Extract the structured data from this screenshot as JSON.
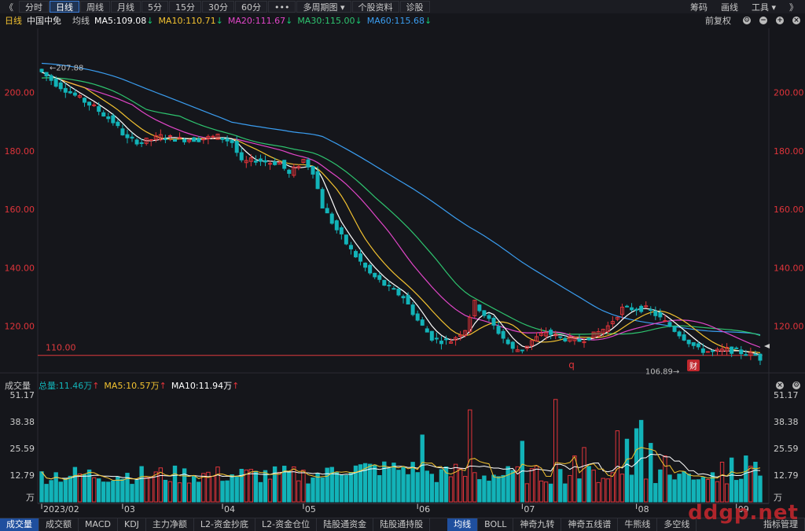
{
  "toolbar": {
    "nav_left": "《",
    "items": [
      "分时",
      "日线",
      "周线",
      "月线",
      "5分",
      "15分",
      "30分",
      "60分",
      "•••",
      "多周期图 ▾",
      "个股资料",
      "诊股"
    ],
    "active_index": 1,
    "right": [
      "筹码",
      "画线",
      "工具 ▾",
      "》"
    ]
  },
  "header": {
    "period": "日线",
    "stock_name": "中国中免",
    "ma_label": "均线",
    "ma5": "MA5:109.08",
    "ma10": "MA10:110.71",
    "ma20": "MA20:111.67",
    "ma30": "MA30:115.00",
    "ma60": "MA60:115.68",
    "adjust": "前复权"
  },
  "volume_header": {
    "label": "成交量",
    "total": "总量:11.46万",
    "ma5": "MA5:10.57万",
    "ma10": "MA10:11.94万"
  },
  "bottom_tabs": [
    "成交量",
    "成交额",
    "MACD",
    "KDJ",
    "主力净额",
    "L2-资金抄底",
    "L2-资金仓位",
    "陆股通资金",
    "陆股通持股",
    "均线",
    "BOLL",
    "神奇九转",
    "神奇五线谱",
    "牛熊线",
    "多空线"
  ],
  "bottom_active": [
    0,
    9
  ],
  "bottom_right": "指标管理",
  "watermark": "ddgp.net",
  "colors": {
    "up": "#e0343a",
    "down": "#12b3b8",
    "ma5": "#ffffff",
    "ma10": "#f2c230",
    "ma20": "#e146c8",
    "ma30": "#2ec46f",
    "ma60": "#3a9df0",
    "price_axis": "#e0343a",
    "grid_line": "#e03a3e"
  },
  "chart_data": [
    {
      "type": "candlestick",
      "title": "中国中免 日线",
      "ylim": [
        104,
        222
      ],
      "yticks": [
        "200.00",
        "180.00",
        "160.00",
        "140.00",
        "120.00"
      ],
      "ytick_values": [
        200,
        180,
        160,
        140,
        120
      ],
      "x_labels": [
        "2023/02",
        "03",
        "04",
        "05",
        "06",
        "07",
        "08",
        "09"
      ],
      "x_label_positions": [
        0,
        17,
        38,
        55,
        79,
        101,
        125,
        146
      ],
      "reference_line": {
        "value": 110,
        "label": "110.00"
      },
      "annotations": {
        "high": "207.88",
        "low": "106.89",
        "q_marker": "q",
        "fin_marker": "财"
      },
      "anchors": [
        [
          0,
          207
        ],
        [
          3,
          203
        ],
        [
          7,
          199
        ],
        [
          11,
          195
        ],
        [
          15,
          190
        ],
        [
          18,
          184
        ],
        [
          21,
          183
        ],
        [
          25,
          185
        ],
        [
          29,
          184
        ],
        [
          33,
          184
        ],
        [
          37,
          185
        ],
        [
          40,
          183
        ],
        [
          42,
          176
        ],
        [
          45,
          177
        ],
        [
          48,
          176
        ],
        [
          50,
          176
        ],
        [
          52,
          172
        ],
        [
          55,
          177
        ],
        [
          57,
          173
        ],
        [
          59,
          161
        ],
        [
          62,
          153
        ],
        [
          65,
          146
        ],
        [
          69,
          138
        ],
        [
          73,
          133
        ],
        [
          76,
          130
        ],
        [
          79,
          122
        ],
        [
          82,
          116
        ],
        [
          84,
          115
        ],
        [
          86,
          115
        ],
        [
          89,
          119
        ],
        [
          91,
          128
        ],
        [
          93,
          124
        ],
        [
          95,
          120
        ],
        [
          97,
          116
        ],
        [
          99,
          112
        ],
        [
          101,
          112
        ],
        [
          103,
          115
        ],
        [
          106,
          118
        ],
        [
          109,
          116
        ],
        [
          113,
          115
        ],
        [
          116,
          117
        ],
        [
          119,
          120
        ],
        [
          122,
          126
        ],
        [
          124,
          126
        ],
        [
          127,
          126
        ],
        [
          129,
          124
        ],
        [
          132,
          120
        ],
        [
          135,
          116
        ],
        [
          138,
          112
        ],
        [
          141,
          111
        ],
        [
          144,
          112
        ],
        [
          147,
          111
        ],
        [
          150,
          110
        ],
        [
          151,
          109
        ]
      ],
      "ma5_last": 109.08,
      "ma10_last": 110.71,
      "ma20_last": 111.67,
      "ma30_last": 115.0,
      "ma60_last": 115.68,
      "ma30_start": 205,
      "ma60_start": 210
    },
    {
      "type": "bar",
      "title": "成交量",
      "unit": "万",
      "ylim": [
        0,
        51.17
      ],
      "yticks": [
        "51.17",
        "38.38",
        "25.59",
        "12.79"
      ],
      "ytick_values": [
        51.17,
        38.38,
        25.59,
        12.79
      ],
      "spikes": [
        [
          80,
          32
        ],
        [
          87,
          18
        ],
        [
          90,
          44
        ],
        [
          101,
          29
        ],
        [
          108,
          49
        ],
        [
          112,
          22
        ],
        [
          114,
          26
        ],
        [
          121,
          34
        ],
        [
          123,
          30
        ],
        [
          125,
          35
        ],
        [
          126,
          39
        ],
        [
          128,
          28
        ],
        [
          131,
          22
        ],
        [
          143,
          19
        ],
        [
          145,
          21
        ],
        [
          148,
          22
        ],
        [
          150,
          19
        ]
      ],
      "base_level": 12
    }
  ]
}
